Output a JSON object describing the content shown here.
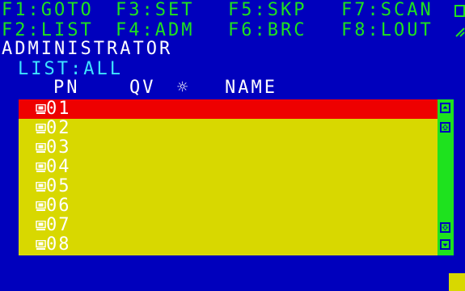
{
  "function_keys": {
    "row1": [
      "F1:GOTO",
      "F3:SET",
      "F5:SKP",
      "F7:SCAN"
    ],
    "row2": [
      "F2:LIST",
      "F4:ADM",
      "F6:BRC",
      "F8:LOUT"
    ]
  },
  "user": "ADMINISTRATOR",
  "list_mode": "LIST:ALL",
  "columns": {
    "pn": "PN",
    "qv": "QV",
    "sun": "☼",
    "name": "NAME"
  },
  "ports": [
    {
      "pn": "01",
      "selected": true
    },
    {
      "pn": "02",
      "selected": false
    },
    {
      "pn": "03",
      "selected": false
    },
    {
      "pn": "04",
      "selected": false
    },
    {
      "pn": "05",
      "selected": false
    },
    {
      "pn": "06",
      "selected": false
    },
    {
      "pn": "07",
      "selected": false
    },
    {
      "pn": "08",
      "selected": false
    }
  ],
  "colors": {
    "background": "#0000bd",
    "menu": "#1ee21e",
    "header_accent": "#3fe3ff",
    "list_bg": "#d8d800",
    "selection": "#ee0000"
  }
}
